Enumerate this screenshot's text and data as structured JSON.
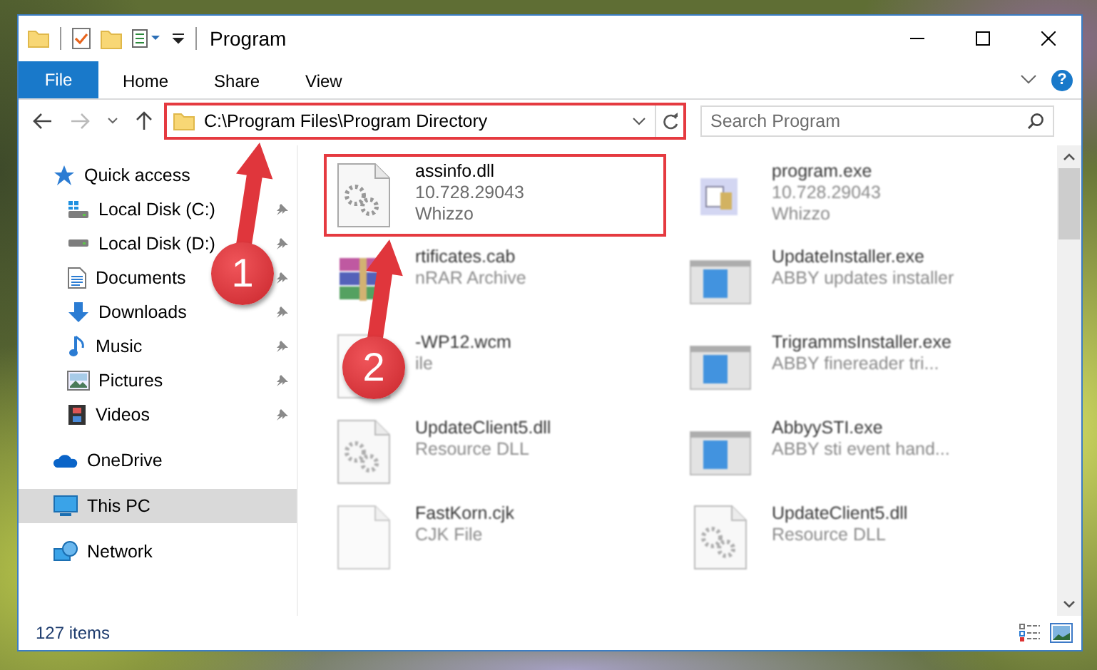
{
  "window": {
    "title": "Program"
  },
  "ribbon": {
    "tabs": [
      {
        "label": "File",
        "kind": "file"
      },
      {
        "label": "Home",
        "kind": "tab",
        "selected": false
      },
      {
        "label": "Share",
        "kind": "tab",
        "selected": false
      },
      {
        "label": "View",
        "kind": "tab",
        "selected": false
      }
    ],
    "help": "?"
  },
  "address_bar": {
    "path": "C:\\Program Files\\Program Directory",
    "highlighted": true
  },
  "search": {
    "placeholder": "Search Program"
  },
  "sidebar": {
    "items": [
      {
        "label": "Quick access",
        "kind": "star",
        "selected": false,
        "children": [
          {
            "label": "Local Disk (C:)",
            "kind": "system-drive",
            "pinned": true,
            "selected": false
          },
          {
            "label": "Local Disk (D:)",
            "kind": "drive",
            "pinned": true,
            "selected": false
          },
          {
            "label": "Documents",
            "kind": "documents",
            "pinned": true,
            "selected": false
          },
          {
            "label": "Downloads",
            "kind": "downloads",
            "pinned": true,
            "selected": false
          },
          {
            "label": "Music",
            "kind": "music",
            "pinned": true,
            "selected": false
          },
          {
            "label": "Pictures",
            "kind": "pictures",
            "pinned": true,
            "selected": false
          },
          {
            "label": "Videos",
            "kind": "videos",
            "pinned": true,
            "selected": false
          }
        ]
      },
      {
        "label": "OneDrive",
        "kind": "cloud",
        "selected": false
      },
      {
        "label": "This PC",
        "kind": "computer",
        "selected": true
      },
      {
        "label": "Network",
        "kind": "network",
        "selected": false
      }
    ]
  },
  "files": [
    {
      "name": "assinfo.dll",
      "details": [
        "10.728.29043",
        "Whizzo"
      ],
      "kind": "dll",
      "highlighted": true,
      "blurred": false
    },
    {
      "name": "program.exe",
      "details": [
        "10.728.29043",
        "Whizzo"
      ],
      "kind": "exe",
      "highlighted": false,
      "blurred": true
    },
    {
      "name": "rtificates.cab",
      "details": [
        "nRAR Archive"
      ],
      "kind": "archive",
      "highlighted": false,
      "blurred": true
    },
    {
      "name": "UpdateInstaller.exe",
      "details": [
        "ABBY updates installer"
      ],
      "kind": "installer",
      "highlighted": false,
      "blurred": true
    },
    {
      "name": "-WP12.wcm",
      "details": [
        "ile"
      ],
      "kind": "file",
      "highlighted": false,
      "blurred": true
    },
    {
      "name": "TrigrammsInstaller.exe",
      "details": [
        "ABBY finereader tri..."
      ],
      "kind": "installer",
      "highlighted": false,
      "blurred": true
    },
    {
      "name": "UpdateClient5.dll",
      "details": [
        "Resource DLL"
      ],
      "kind": "dll",
      "highlighted": false,
      "blurred": true
    },
    {
      "name": "AbbyySTI.exe",
      "details": [
        "ABBY sti event hand..."
      ],
      "kind": "installer",
      "highlighted": false,
      "blurred": true
    },
    {
      "name": "FastKorn.cjk",
      "details": [
        "CJK File"
      ],
      "kind": "file",
      "highlighted": false,
      "blurred": true
    },
    {
      "name": "UpdateClient5.dll",
      "details": [
        "Resource DLL"
      ],
      "kind": "dll",
      "highlighted": false,
      "blurred": true
    }
  ],
  "status_bar": {
    "item_count": "127 items"
  },
  "callouts": [
    {
      "number": "1"
    },
    {
      "number": "2"
    }
  ]
}
